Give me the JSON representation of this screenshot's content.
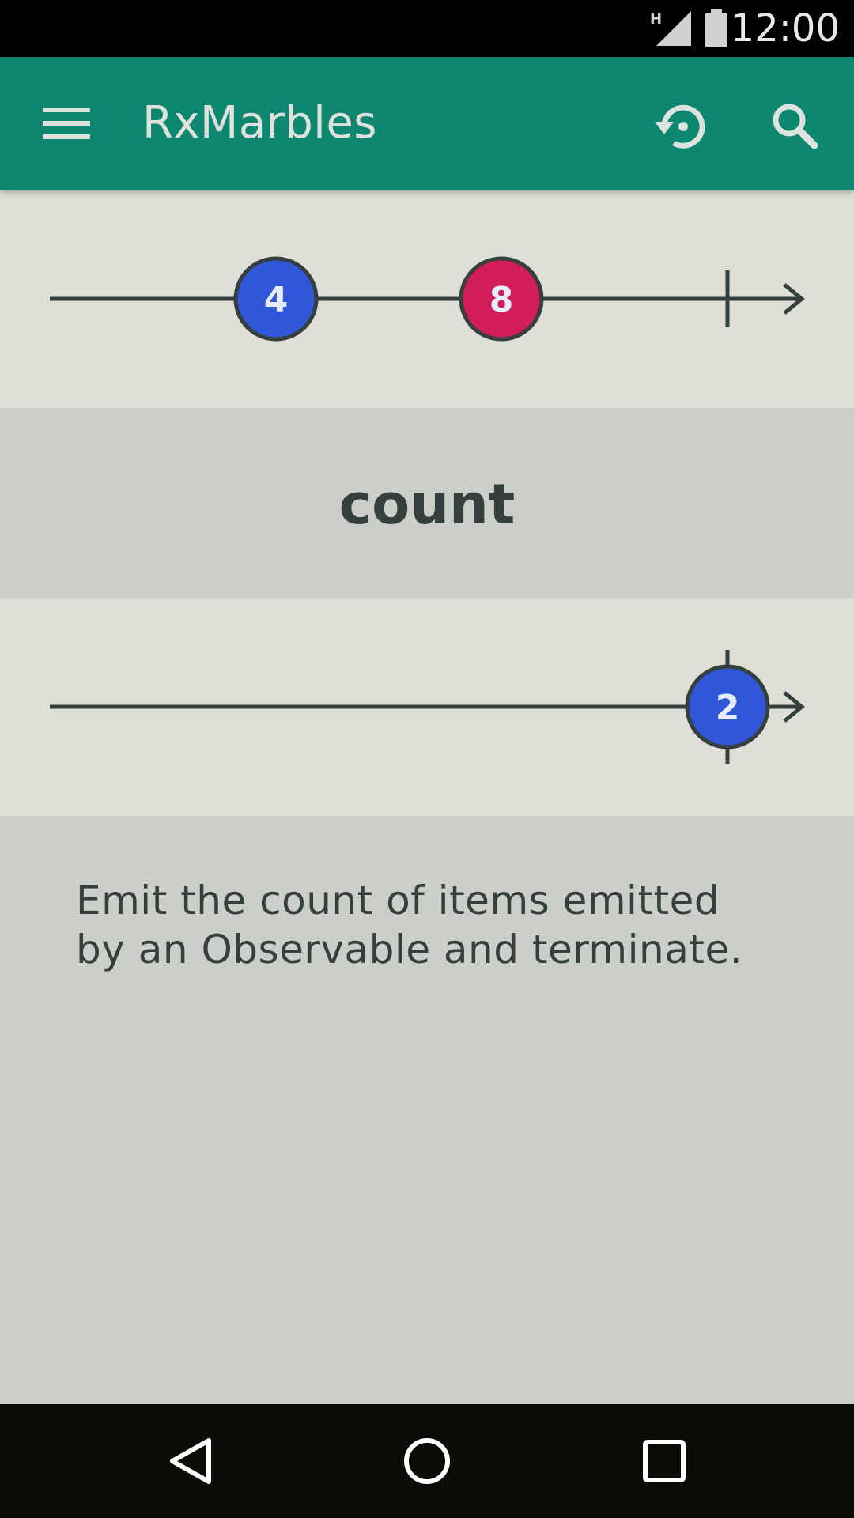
{
  "status_bar": {
    "time": "12:00",
    "network_label": "H",
    "icons": [
      "signal-icon",
      "battery-icon"
    ]
  },
  "app_bar": {
    "title": "RxMarbles",
    "icons": [
      "menu-icon",
      "reset-icon",
      "search-icon"
    ]
  },
  "input_timeline": {
    "marbles": [
      {
        "label": "4",
        "color": "#2f57d8"
      },
      {
        "label": "8",
        "color": "#d21e58"
      }
    ],
    "completed": true
  },
  "operator": {
    "name": "count"
  },
  "output_timeline": {
    "marbles": [
      {
        "label": "2",
        "color": "#2f57d8"
      }
    ],
    "completed": true
  },
  "description": "Emit the count of items emitted by an Observable and terminate.",
  "nav_bar": {
    "icons": [
      "back-icon",
      "home-icon",
      "recents-icon"
    ]
  },
  "colors": {
    "app_bar": "#0d8770",
    "timeline_bg": "#dfdfd7",
    "panel_bg": "#cccfc9",
    "ink": "#353f3d"
  }
}
